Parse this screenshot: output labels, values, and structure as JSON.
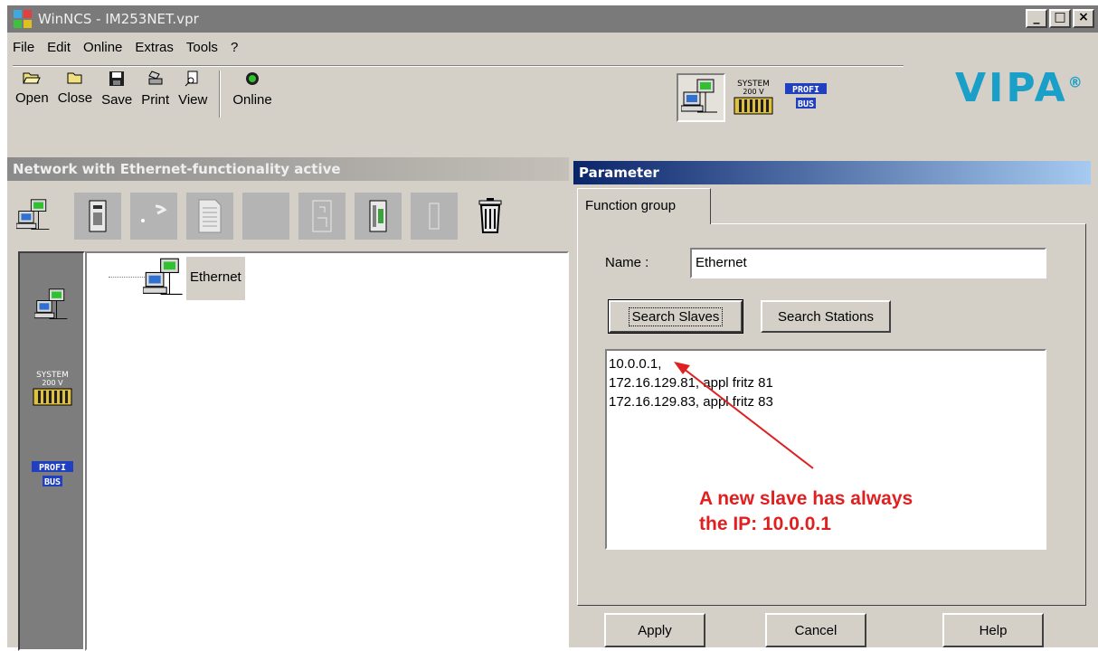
{
  "window": {
    "title": "WinNCS - IM253NET.vpr"
  },
  "menu": [
    "File",
    "Edit",
    "Online",
    "Extras",
    "Tools",
    "?"
  ],
  "toolbar": {
    "open": "Open",
    "close": "Close",
    "save": "Save",
    "print": "Print",
    "view": "View",
    "online": "Online"
  },
  "mode_icons": {
    "system_top": "SYSTEM",
    "system_bottom": "200 V",
    "profi": "PROFI",
    "bus": "BUS"
  },
  "brand": {
    "logo": "VIPA",
    "reg": "®",
    "accent": "#1aa0c8"
  },
  "left_panel": {
    "title": "Network with Ethernet-functionality active",
    "palette": {
      "system_top": "SYSTEM",
      "system_bottom": "200 V",
      "profi": "PROFI",
      "bus": "BUS"
    },
    "tree": {
      "root_label": "Ethernet"
    }
  },
  "parameter": {
    "title": "Parameter",
    "tab": "Function group",
    "name_label": "Name :",
    "name_value": "Ethernet",
    "search_slaves": "Search Slaves",
    "search_stations": "Search Stations",
    "list": [
      "10.0.0.1,",
      "172.16.129.81, appl fritz 81",
      "172.16.129.83, appl fritz 83"
    ],
    "annotation_line1": "A new slave has always",
    "annotation_line2": "the IP: 10.0.0.1",
    "annotation_color": "#e02020",
    "apply": "Apply",
    "cancel": "Cancel",
    "help": "Help"
  }
}
